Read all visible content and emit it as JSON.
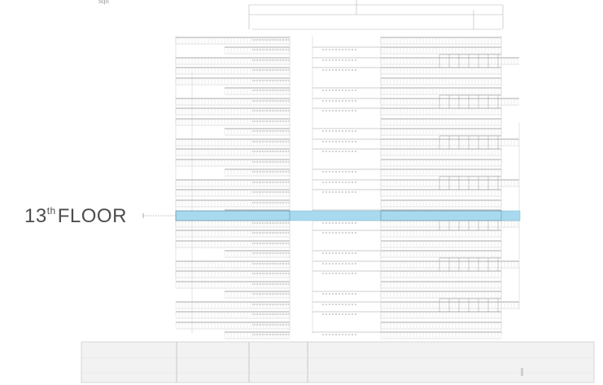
{
  "area_unit": "sqft",
  "selected_floor": {
    "number": "13",
    "suffix": "th",
    "word": "FLOOR"
  },
  "colors": {
    "highlight": "#a9d9ee",
    "highlight_stroke": "#79b9d6",
    "linework": "#9a9a9a",
    "podium_fill": "#f1f1f1",
    "label_text": "#4d4d4d"
  }
}
